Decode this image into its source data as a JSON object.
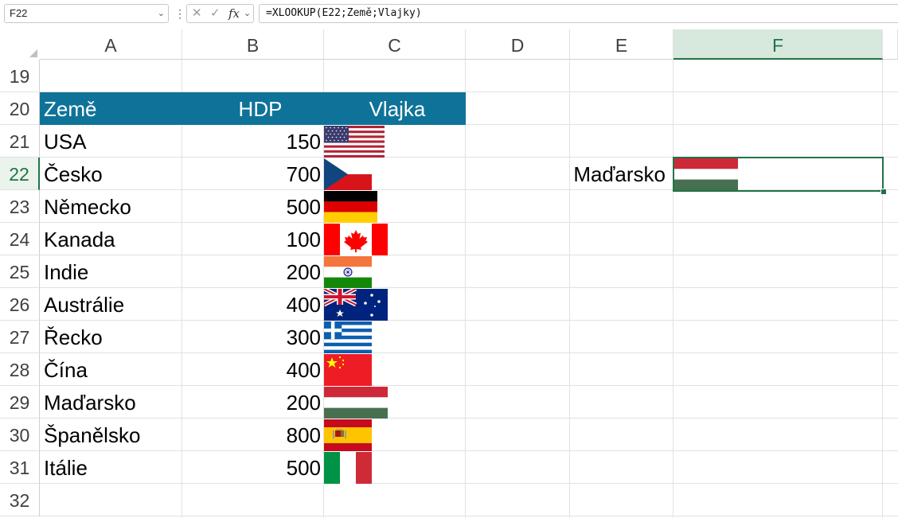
{
  "formula_bar": {
    "name_box": "F22",
    "formula": "=XLOOKUP(E22;Země;Vlajky)",
    "fx_label": "fx"
  },
  "columns": [
    {
      "label": "A"
    },
    {
      "label": "B"
    },
    {
      "label": "C"
    },
    {
      "label": "D"
    },
    {
      "label": "E"
    },
    {
      "label": "F"
    }
  ],
  "selected_column": "F",
  "rows": [
    "19",
    "20",
    "21",
    "22",
    "23",
    "24",
    "25",
    "26",
    "27",
    "28",
    "29",
    "30",
    "31",
    "32"
  ],
  "selected_row": "22",
  "table": {
    "headers": {
      "country": "Země",
      "gdp": "HDP",
      "flag": "Vlajka"
    },
    "header_color": "#0f7399",
    "entries": [
      {
        "country": "USA",
        "gdp": "150",
        "flag": "usa-flag"
      },
      {
        "country": "Česko",
        "gdp": "700",
        "flag": "czech-flag"
      },
      {
        "country": "Německo",
        "gdp": "500",
        "flag": "germany-flag"
      },
      {
        "country": "Kanada",
        "gdp": "100",
        "flag": "canada-flag"
      },
      {
        "country": "Indie",
        "gdp": "200",
        "flag": "india-flag"
      },
      {
        "country": "Austrálie",
        "gdp": "400",
        "flag": "australia-flag"
      },
      {
        "country": "Řecko",
        "gdp": "300",
        "flag": "greece-flag"
      },
      {
        "country": "Čína",
        "gdp": "400",
        "flag": "china-flag"
      },
      {
        "country": "Maďarsko",
        "gdp": "200",
        "flag": "hungary-flag"
      },
      {
        "country": "Španělsko",
        "gdp": "800",
        "flag": "spain-flag"
      },
      {
        "country": "Itálie",
        "gdp": "500",
        "flag": "italy-flag"
      }
    ]
  },
  "lookup": {
    "input": "Maďarsko",
    "result_flag": "hungary-flag"
  },
  "accent_color": "#217346"
}
